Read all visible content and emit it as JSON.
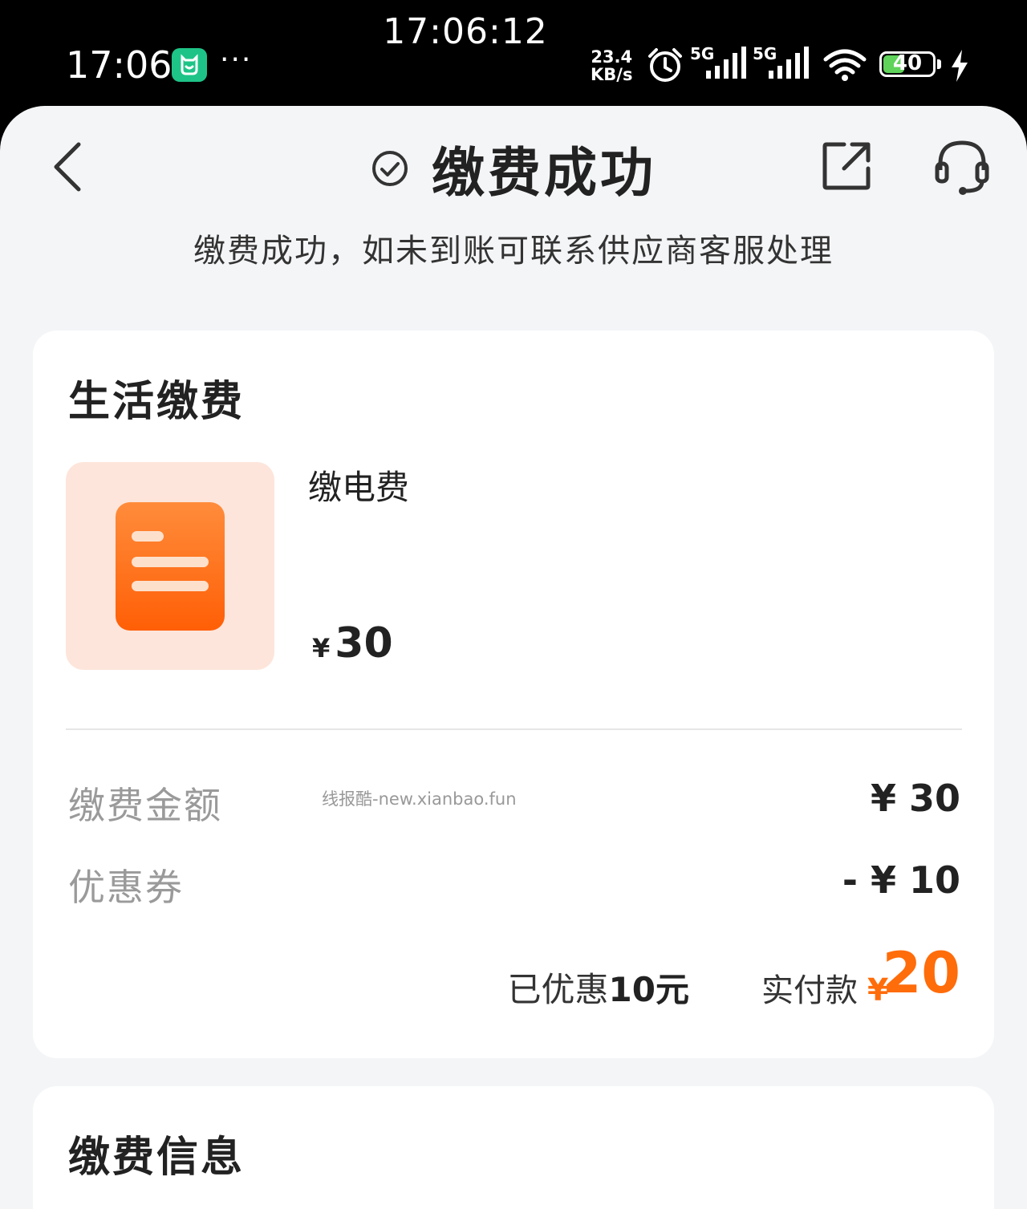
{
  "status_bar": {
    "center_time": "17:06:12",
    "time": "17:06",
    "more": "···",
    "net_speed_value": "23.4",
    "net_speed_unit": "KB/s",
    "signal_1": "5G",
    "signal_2": "5G",
    "battery": "40"
  },
  "nav": {
    "title": "缴费成功",
    "subtitle": "缴费成功，如未到账可联系供应商客服处理"
  },
  "order_card": {
    "title": "生活缴费",
    "item_name": "缴电费",
    "item_price_currency": "¥",
    "item_price": "30",
    "rows": [
      {
        "label": "缴费金额",
        "value": "¥ 30"
      },
      {
        "label": "优惠券",
        "value": "- ¥ 10"
      }
    ],
    "watermark": "线报酷-new.xianbao.fun",
    "saved_prefix": "已优惠",
    "saved_amount": "10元",
    "paid_label": "实付款",
    "paid_currency": "¥",
    "paid_amount": "20"
  },
  "info_card": {
    "title": "缴费信息"
  },
  "colors": {
    "accent": "#ff6c0a",
    "background": "#f4f5f7",
    "card": "#ffffff",
    "status_bar": "#000000"
  },
  "icons": [
    "back-icon",
    "check-circle-icon",
    "share-icon",
    "customer-service-icon",
    "bill-document-icon"
  ]
}
